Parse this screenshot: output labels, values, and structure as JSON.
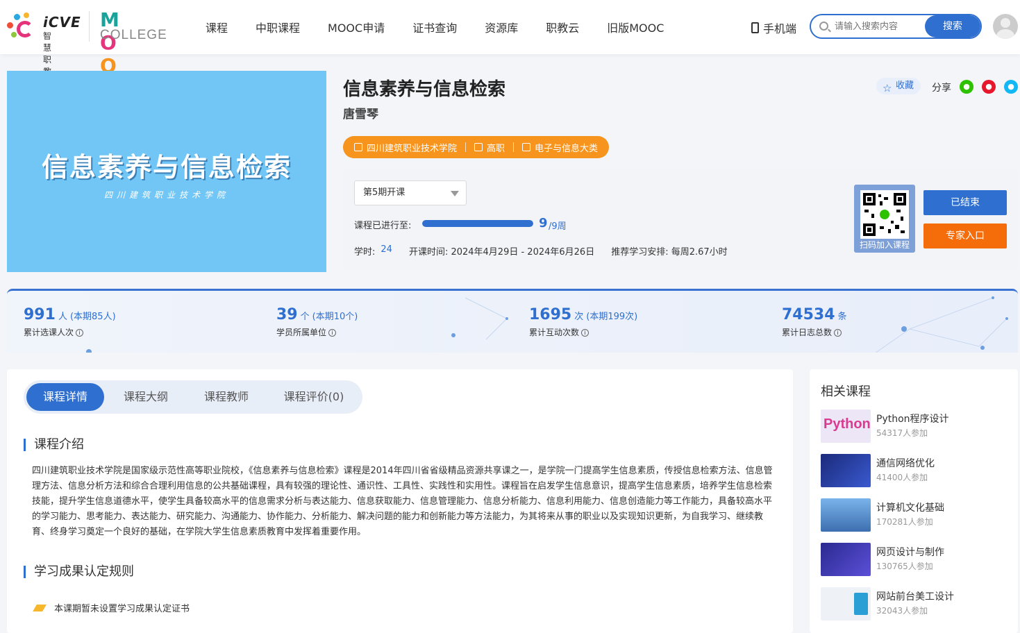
{
  "header": {
    "logo_brand": "iCVE",
    "logo_sub": "智慧职教",
    "mooc_label": "MOOC",
    "college_label": "COLLEGE",
    "nav": [
      "课程",
      "中职课程",
      "MOOC申请",
      "证书查询",
      "资源库",
      "职教云",
      "旧版MOOC"
    ],
    "mobile_label": "手机端",
    "search_placeholder": "请输入搜索内容",
    "search_button": "搜索"
  },
  "course": {
    "cover_title": "信息素养与信息检索",
    "cover_sub": "四川建筑职业技术学院",
    "title": "信息素养与信息检索",
    "teacher": "唐雪琴",
    "favorite_label": "收藏",
    "share_label": "分享",
    "tags": [
      "四川建筑职业技术学院",
      "高职",
      "电子与信息大类"
    ],
    "session_selected": "第5期开课",
    "progress_label": "课程已进行至:",
    "progress_current": "9",
    "progress_total": "/9周",
    "progress_fraction": 1.0,
    "hours_label": "学时:",
    "hours_value": "24",
    "dates": "开课时间: 2024年4月29日 - 2024年6月26日",
    "schedule": "推荐学习安排:  每周2.67小时",
    "qr_label": "扫码加入课程",
    "ended_button": "已结束",
    "expert_button": "专家入口"
  },
  "stats": [
    {
      "num": "991",
      "unit": "人",
      "extra": "(本期85人)",
      "label": "累计选课人次"
    },
    {
      "num": "39",
      "unit": "个",
      "extra": "(本期10个)",
      "label": "学员所属单位"
    },
    {
      "num": "1695",
      "unit": "次",
      "extra": "(本期199次)",
      "label": "累计互动次数"
    },
    {
      "num": "74534",
      "unit": "条",
      "extra": "",
      "label": "累计日志总数"
    }
  ],
  "tabs": [
    "课程详情",
    "课程大纲",
    "课程教师",
    "课程评价(0)"
  ],
  "intro": {
    "title": "课程介绍",
    "text": "四川建筑职业技术学院是国家级示范性高等职业院校，《信息素养与信息检索》课程是2014年四川省省级精品资源共享课之一，是学院一门提高学生信息素质，传授信息检索方法、信息管理方法、信息分析方法和综合合理利用信息的公共基础课程，具有较强的理论性、通识性、工具性、实践性和实用性。课程旨在启发学生信息意识，提高学生信息素质，培养学生信息检索技能，提升学生信息道德水平，使学生具备较高水平的信息需求分析与表达能力、信息获取能力、信息管理能力、信息分析能力、信息利用能力、信息创造能力等工作能力，具备较高水平的学习能力、思考能力、表达能力、研究能力、沟通能力、协作能力、分析能力、解决问题的能力和创新能力等方法能力，为其将来从事的职业以及实现知识更新，为自我学习、继续教育、终身学习奠定一个良好的基础，在学院大学生信息素质教育中发挥着重要作用。"
  },
  "rules": {
    "title": "学习成果认定规则",
    "text": "本课期暂未设置学习成果认定证书"
  },
  "related": {
    "title": "相关课程",
    "items": [
      {
        "name": "Python程序设计",
        "count": "54317人参加",
        "color": "#e9e4f5"
      },
      {
        "name": "通信网络优化",
        "count": "41400人参加",
        "color": "#2a3f9a"
      },
      {
        "name": "计算机文化基础",
        "count": "170281人参加",
        "color": "#5a8fd0"
      },
      {
        "name": "网页设计与制作",
        "count": "130765人参加",
        "color": "#3b3aa8"
      },
      {
        "name": "网站前台美工设计",
        "count": "32043人参加",
        "color": "#e8eef5"
      }
    ]
  },
  "colors": {
    "accent": "#2e6fd0",
    "tag_orange": "#f7941d",
    "expert_orange": "#f56c0b"
  }
}
